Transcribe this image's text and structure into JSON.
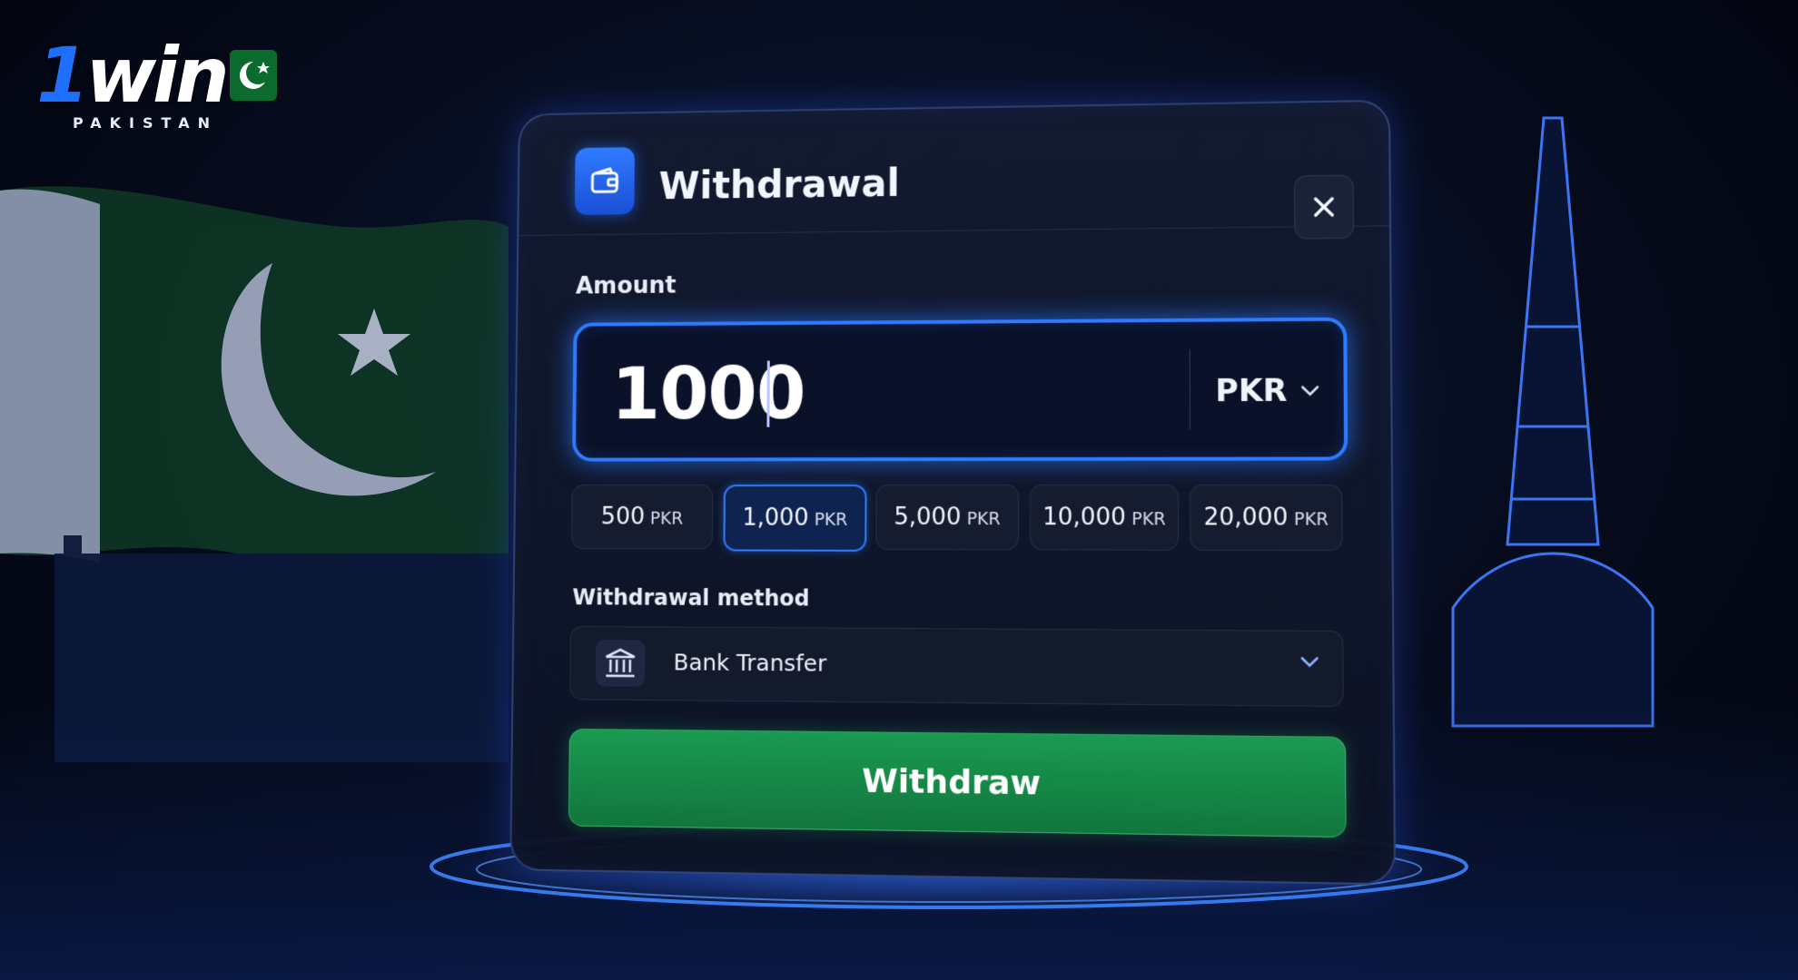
{
  "brand": {
    "logo_text_one": "1",
    "logo_text_rest": "win",
    "subtitle": "PAKISTAN"
  },
  "modal": {
    "title": "Withdrawal",
    "header_icon": "wallet-icon",
    "close_icon": "close-icon"
  },
  "amount": {
    "label": "Amount",
    "value": "1000",
    "currency": "PKR",
    "currency_icon": "chevron-down-icon"
  },
  "presets": [
    {
      "amount": "500",
      "currency": "PKR",
      "active": false
    },
    {
      "amount": "1,000",
      "currency": "PKR",
      "active": true
    },
    {
      "amount": "5,000",
      "currency": "PKR",
      "active": false
    },
    {
      "amount": "10,000",
      "currency": "PKR",
      "active": false
    },
    {
      "amount": "20,000",
      "currency": "PKR",
      "active": false
    }
  ],
  "method": {
    "label": "Withdrawal method",
    "value": "Bank Transfer",
    "icon": "bank-icon"
  },
  "withdraw_button": {
    "label": "Withdraw"
  },
  "colors": {
    "accent_blue": "#2e7bff",
    "button_green": "#1a9a52",
    "panel_bg": "#0c1224"
  }
}
